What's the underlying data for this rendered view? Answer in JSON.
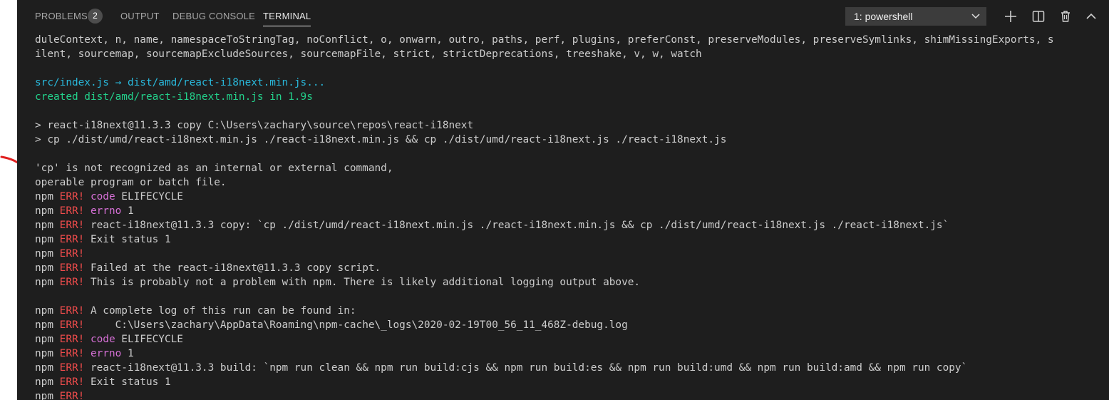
{
  "panel_tabs": {
    "problems": "PROBLEMS",
    "problems_count": "2",
    "output": "OUTPUT",
    "debug_console": "DEBUG CONSOLE",
    "terminal": "TERMINAL"
  },
  "terminal_selector": {
    "selected": "1: powershell"
  },
  "toolbar_icons": [
    "add-terminal-icon",
    "split-terminal-icon",
    "trash-icon",
    "maximize-panel-icon"
  ],
  "colors": {
    "background": "#1e1e1e",
    "text": "#cccccc",
    "cyan": "#29b8db",
    "green": "#23d18b",
    "error_red": "#f14c4c",
    "magenta": "#d670d6",
    "annotation_arrow": "#e02020"
  },
  "terminal": {
    "lines": [
      [
        {
          "t": "duleContext, n, name, namespaceToStringTag, noConflict, o, onwarn, outro, paths, perf, plugins, preferConst, preserveModules, preserveSymlinks, shimMissingExports, s"
        }
      ],
      [
        {
          "t": "ilent, sourcemap, sourcemapExcludeSources, sourcemapFile, strict, strictDeprecations, treeshake, v, w, watch"
        }
      ],
      [],
      [
        {
          "t": "src/index.js → dist/amd/react-i18next.min.js...",
          "c": "cyan"
        }
      ],
      [
        {
          "t": "created dist/amd/react-i18next.min.js in 1.9s",
          "c": "green"
        }
      ],
      [],
      [
        {
          "t": "> react-i18next@11.3.3 copy C:\\Users\\zachary\\source\\repos\\react-i18next"
        }
      ],
      [
        {
          "t": "> cp ./dist/umd/react-i18next.min.js ./react-i18next.min.js && cp ./dist/umd/react-i18next.js ./react-i18next.js"
        }
      ],
      [],
      [
        {
          "t": "'cp' is not recognized as an internal or external command,"
        }
      ],
      [
        {
          "t": "operable program or batch file."
        }
      ],
      [
        {
          "t": "npm "
        },
        {
          "t": "ERR!",
          "c": "red"
        },
        {
          "t": " "
        },
        {
          "t": "code",
          "c": "magenta"
        },
        {
          "t": " ELIFECYCLE"
        }
      ],
      [
        {
          "t": "npm "
        },
        {
          "t": "ERR!",
          "c": "red"
        },
        {
          "t": " "
        },
        {
          "t": "errno",
          "c": "magenta"
        },
        {
          "t": " 1"
        }
      ],
      [
        {
          "t": "npm "
        },
        {
          "t": "ERR!",
          "c": "red"
        },
        {
          "t": " react-i18next@11.3.3 copy: `cp ./dist/umd/react-i18next.min.js ./react-i18next.min.js && cp ./dist/umd/react-i18next.js ./react-i18next.js`"
        }
      ],
      [
        {
          "t": "npm "
        },
        {
          "t": "ERR!",
          "c": "red"
        },
        {
          "t": " Exit status 1"
        }
      ],
      [
        {
          "t": "npm "
        },
        {
          "t": "ERR!",
          "c": "red"
        }
      ],
      [
        {
          "t": "npm "
        },
        {
          "t": "ERR!",
          "c": "red"
        },
        {
          "t": " Failed at the react-i18next@11.3.3 copy script."
        }
      ],
      [
        {
          "t": "npm "
        },
        {
          "t": "ERR!",
          "c": "red"
        },
        {
          "t": " This is probably not a problem with npm. There is likely additional logging output above."
        }
      ],
      [],
      [
        {
          "t": "npm "
        },
        {
          "t": "ERR!",
          "c": "red"
        },
        {
          "t": " A complete log of this run can be found in:"
        }
      ],
      [
        {
          "t": "npm "
        },
        {
          "t": "ERR!",
          "c": "red"
        },
        {
          "t": "     C:\\Users\\zachary\\AppData\\Roaming\\npm-cache\\_logs\\2020-02-19T00_56_11_468Z-debug.log"
        }
      ],
      [
        {
          "t": "npm "
        },
        {
          "t": "ERR!",
          "c": "red"
        },
        {
          "t": " "
        },
        {
          "t": "code",
          "c": "magenta"
        },
        {
          "t": " ELIFECYCLE"
        }
      ],
      [
        {
          "t": "npm "
        },
        {
          "t": "ERR!",
          "c": "red"
        },
        {
          "t": " "
        },
        {
          "t": "errno",
          "c": "magenta"
        },
        {
          "t": " 1"
        }
      ],
      [
        {
          "t": "npm "
        },
        {
          "t": "ERR!",
          "c": "red"
        },
        {
          "t": " react-i18next@11.3.3 build: `npm run clean && npm run build:cjs && npm run build:es && npm run build:umd && npm run build:amd && npm run copy`"
        }
      ],
      [
        {
          "t": "npm "
        },
        {
          "t": "ERR!",
          "c": "red"
        },
        {
          "t": " Exit status 1"
        }
      ],
      [
        {
          "t": "npm "
        },
        {
          "t": "ERR!",
          "c": "red"
        }
      ]
    ]
  }
}
